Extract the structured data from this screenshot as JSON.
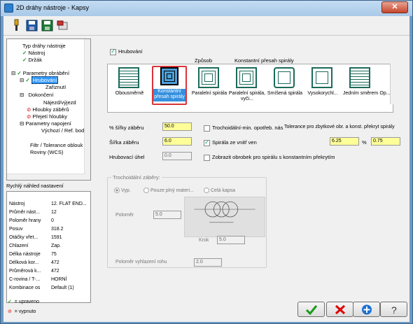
{
  "window": {
    "title": "2D dráhy nástroje - Kapsy",
    "close": "✕"
  },
  "toolbar": {
    "icons": [
      "pin-icon",
      "save-icon",
      "save-all-icon",
      "options-icon"
    ]
  },
  "tree": [
    {
      "label": "Typ dráhy nástroje",
      "state": ""
    },
    {
      "label": "Nástroj",
      "state": "check"
    },
    {
      "label": "Držák",
      "state": "check"
    },
    {
      "label": "Parametry obrábění",
      "state": "check"
    },
    {
      "label": "Hrubování",
      "state": "check"
    },
    {
      "label": "Zařiznutí",
      "state": ""
    },
    {
      "label": "Dokončení",
      "state": ""
    },
    {
      "label": "Nájezd/výjezd",
      "state": ""
    },
    {
      "label": "Hloubky záběrů",
      "state": "off"
    },
    {
      "label": "Přejetí hloubky",
      "state": "off"
    },
    {
      "label": "Parametry napojení",
      "state": ""
    },
    {
      "label": "Výchozí / Ref. bod",
      "state": ""
    },
    {
      "label": "Filtr / Tolerance oblouk",
      "state": ""
    },
    {
      "label": "Roviny (WCS)",
      "state": ""
    }
  ],
  "quickview": {
    "label": "Rychlý náhled nastavení",
    "rows": [
      [
        "Nástroj",
        "12. FLAT END..."
      ],
      [
        "Průměr nást...",
        "12"
      ],
      [
        "Poloměr hrany",
        "0"
      ],
      [
        "Posuv",
        "318.2"
      ],
      [
        "Otáčky vřet...",
        "1591"
      ],
      [
        "Chlazení",
        "Zap."
      ],
      [
        "Délka nástroje",
        "75"
      ],
      [
        "Délková kor...",
        "472"
      ],
      [
        "Průměrová k...",
        "472"
      ],
      [
        "C-rovina / T-...",
        "HORNÍ"
      ],
      [
        "Kombinace os",
        "Default (1)"
      ]
    ]
  },
  "legend": {
    "edited": "= upraveno",
    "disabled": "= vypnuto"
  },
  "roughing": {
    "checkbox": "Hrubování",
    "method_label": "Způsob",
    "method_value": "Konstantní přesah spirály",
    "methods": [
      "Obousměrně",
      "Konstantní přesah spirály",
      "Paralelní spirála",
      "Paralelní spirála, vyči...",
      "Smíšená spirála",
      "Vysokorychl...",
      "Jedním směrem",
      "Op..."
    ],
    "stepover_pct_label": "% šířky záběru",
    "stepover_pct": "50.0",
    "stepover_label": "Šířka záběru",
    "stepover": "6.0",
    "angle_label": "Hrubovací úhel",
    "angle": "0.0",
    "trochoid_min": "Trochoidální-min. opotřeb. nás",
    "tolerance_label": "Tolerance pro zbytkové obr. a konst. překryt spirály",
    "spiral_inside": "Spirála ze vnitř ven",
    "tolerance_val": "6.25",
    "tolerance_pct": "%",
    "tolerance_val2": "0.75",
    "show_stock": "Zobrazit obrobek pro spirálu s konstantním překrytím"
  },
  "trochoid": {
    "group_label": "Trochoidální záběry:",
    "opt_off": "Vyp.",
    "opt_full": "Pouze plný materi...",
    "opt_whole": "Celá kapsa",
    "radius_label": "Poloměr",
    "radius": "5.0",
    "step_label": "Krok",
    "step": "5.0",
    "smooth_label": "Poloměr vyhlazení rohu",
    "smooth": "2.0"
  },
  "buttons": {
    "ok": "ok-button",
    "cancel": "cancel-button",
    "add": "add-button",
    "help": "help-button"
  }
}
